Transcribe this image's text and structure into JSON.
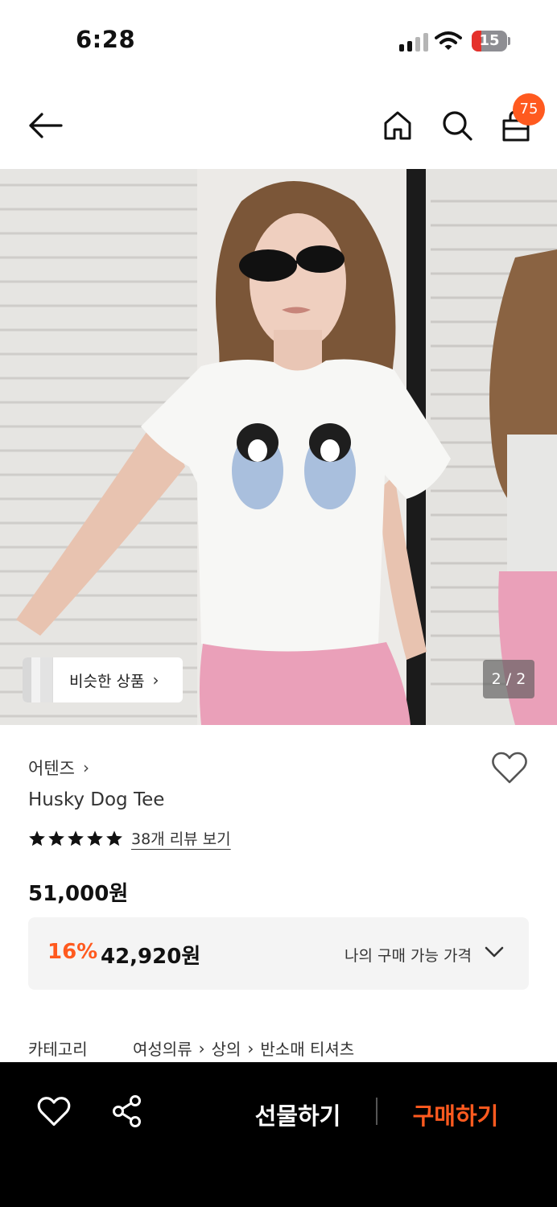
{
  "status_bar": {
    "time": "6:28",
    "battery": "15"
  },
  "header": {
    "cart_count": "75"
  },
  "hero": {
    "similar_label": "비슷한 상품",
    "page_indicator": "2 / 2"
  },
  "product": {
    "brand": "어텐즈",
    "name": "Husky Dog Tee",
    "rating_stars": 5,
    "review_link": "38개 리뷰 보기",
    "price": "51,000원",
    "discount_rate": "16%",
    "discount_price": "42,920원",
    "my_price_label": "나의 구매 가능 가격"
  },
  "category": {
    "label": "카테고리",
    "path": [
      "여성의류",
      "상의",
      "반소매 티셔츠"
    ]
  },
  "bottom_bar": {
    "gift_label": "선물하기",
    "buy_label": "구매하기"
  },
  "colors": {
    "accent": "#ff5a1f",
    "bottom_bar": "#000000"
  }
}
